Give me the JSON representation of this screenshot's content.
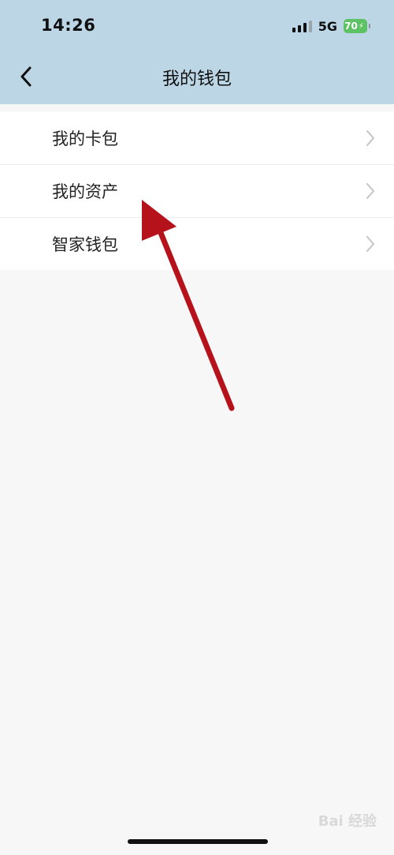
{
  "status_bar": {
    "time": "14:26",
    "network": "5G",
    "battery": "70"
  },
  "header": {
    "title": "我的钱包"
  },
  "menu": {
    "items": [
      {
        "label": "我的卡包"
      },
      {
        "label": "我的资产"
      },
      {
        "label": "智家钱包"
      }
    ]
  },
  "watermark": {
    "text": "Bai 经验"
  },
  "colors": {
    "header_bg": "#bcd6e6",
    "page_bg": "#f7f7f7",
    "arrow": "#b5121b",
    "battery": "#5cc263"
  },
  "icons": [
    "back-icon",
    "chevron-right-icon",
    "signal-icon",
    "battery-icon"
  ]
}
